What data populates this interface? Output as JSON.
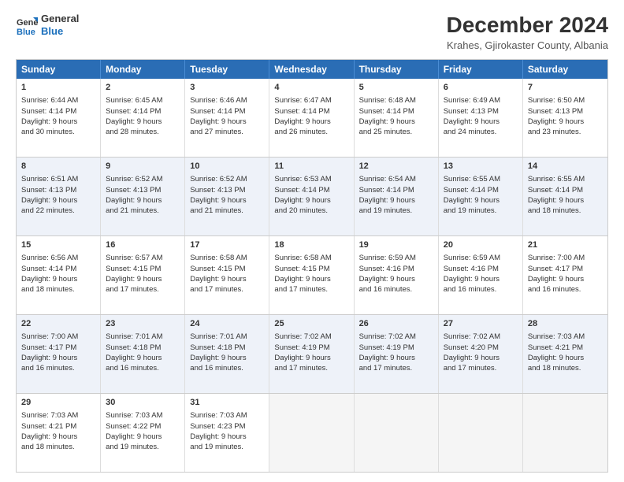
{
  "logo": {
    "general": "General",
    "blue": "Blue"
  },
  "title": "December 2024",
  "subtitle": "Krahes, Gjirokaster County, Albania",
  "weekdays": [
    "Sunday",
    "Monday",
    "Tuesday",
    "Wednesday",
    "Thursday",
    "Friday",
    "Saturday"
  ],
  "weeks": [
    [
      {
        "day": "1",
        "lines": [
          "Sunrise: 6:44 AM",
          "Sunset: 4:14 PM",
          "Daylight: 9 hours",
          "and 30 minutes."
        ]
      },
      {
        "day": "2",
        "lines": [
          "Sunrise: 6:45 AM",
          "Sunset: 4:14 PM",
          "Daylight: 9 hours",
          "and 28 minutes."
        ]
      },
      {
        "day": "3",
        "lines": [
          "Sunrise: 6:46 AM",
          "Sunset: 4:14 PM",
          "Daylight: 9 hours",
          "and 27 minutes."
        ]
      },
      {
        "day": "4",
        "lines": [
          "Sunrise: 6:47 AM",
          "Sunset: 4:14 PM",
          "Daylight: 9 hours",
          "and 26 minutes."
        ]
      },
      {
        "day": "5",
        "lines": [
          "Sunrise: 6:48 AM",
          "Sunset: 4:14 PM",
          "Daylight: 9 hours",
          "and 25 minutes."
        ]
      },
      {
        "day": "6",
        "lines": [
          "Sunrise: 6:49 AM",
          "Sunset: 4:13 PM",
          "Daylight: 9 hours",
          "and 24 minutes."
        ]
      },
      {
        "day": "7",
        "lines": [
          "Sunrise: 6:50 AM",
          "Sunset: 4:13 PM",
          "Daylight: 9 hours",
          "and 23 minutes."
        ]
      }
    ],
    [
      {
        "day": "8",
        "lines": [
          "Sunrise: 6:51 AM",
          "Sunset: 4:13 PM",
          "Daylight: 9 hours",
          "and 22 minutes."
        ]
      },
      {
        "day": "9",
        "lines": [
          "Sunrise: 6:52 AM",
          "Sunset: 4:13 PM",
          "Daylight: 9 hours",
          "and 21 minutes."
        ]
      },
      {
        "day": "10",
        "lines": [
          "Sunrise: 6:52 AM",
          "Sunset: 4:13 PM",
          "Daylight: 9 hours",
          "and 21 minutes."
        ]
      },
      {
        "day": "11",
        "lines": [
          "Sunrise: 6:53 AM",
          "Sunset: 4:14 PM",
          "Daylight: 9 hours",
          "and 20 minutes."
        ]
      },
      {
        "day": "12",
        "lines": [
          "Sunrise: 6:54 AM",
          "Sunset: 4:14 PM",
          "Daylight: 9 hours",
          "and 19 minutes."
        ]
      },
      {
        "day": "13",
        "lines": [
          "Sunrise: 6:55 AM",
          "Sunset: 4:14 PM",
          "Daylight: 9 hours",
          "and 19 minutes."
        ]
      },
      {
        "day": "14",
        "lines": [
          "Sunrise: 6:55 AM",
          "Sunset: 4:14 PM",
          "Daylight: 9 hours",
          "and 18 minutes."
        ]
      }
    ],
    [
      {
        "day": "15",
        "lines": [
          "Sunrise: 6:56 AM",
          "Sunset: 4:14 PM",
          "Daylight: 9 hours",
          "and 18 minutes."
        ]
      },
      {
        "day": "16",
        "lines": [
          "Sunrise: 6:57 AM",
          "Sunset: 4:15 PM",
          "Daylight: 9 hours",
          "and 17 minutes."
        ]
      },
      {
        "day": "17",
        "lines": [
          "Sunrise: 6:58 AM",
          "Sunset: 4:15 PM",
          "Daylight: 9 hours",
          "and 17 minutes."
        ]
      },
      {
        "day": "18",
        "lines": [
          "Sunrise: 6:58 AM",
          "Sunset: 4:15 PM",
          "Daylight: 9 hours",
          "and 17 minutes."
        ]
      },
      {
        "day": "19",
        "lines": [
          "Sunrise: 6:59 AM",
          "Sunset: 4:16 PM",
          "Daylight: 9 hours",
          "and 16 minutes."
        ]
      },
      {
        "day": "20",
        "lines": [
          "Sunrise: 6:59 AM",
          "Sunset: 4:16 PM",
          "Daylight: 9 hours",
          "and 16 minutes."
        ]
      },
      {
        "day": "21",
        "lines": [
          "Sunrise: 7:00 AM",
          "Sunset: 4:17 PM",
          "Daylight: 9 hours",
          "and 16 minutes."
        ]
      }
    ],
    [
      {
        "day": "22",
        "lines": [
          "Sunrise: 7:00 AM",
          "Sunset: 4:17 PM",
          "Daylight: 9 hours",
          "and 16 minutes."
        ]
      },
      {
        "day": "23",
        "lines": [
          "Sunrise: 7:01 AM",
          "Sunset: 4:18 PM",
          "Daylight: 9 hours",
          "and 16 minutes."
        ]
      },
      {
        "day": "24",
        "lines": [
          "Sunrise: 7:01 AM",
          "Sunset: 4:18 PM",
          "Daylight: 9 hours",
          "and 16 minutes."
        ]
      },
      {
        "day": "25",
        "lines": [
          "Sunrise: 7:02 AM",
          "Sunset: 4:19 PM",
          "Daylight: 9 hours",
          "and 17 minutes."
        ]
      },
      {
        "day": "26",
        "lines": [
          "Sunrise: 7:02 AM",
          "Sunset: 4:19 PM",
          "Daylight: 9 hours",
          "and 17 minutes."
        ]
      },
      {
        "day": "27",
        "lines": [
          "Sunrise: 7:02 AM",
          "Sunset: 4:20 PM",
          "Daylight: 9 hours",
          "and 17 minutes."
        ]
      },
      {
        "day": "28",
        "lines": [
          "Sunrise: 7:03 AM",
          "Sunset: 4:21 PM",
          "Daylight: 9 hours",
          "and 18 minutes."
        ]
      }
    ],
    [
      {
        "day": "29",
        "lines": [
          "Sunrise: 7:03 AM",
          "Sunset: 4:21 PM",
          "Daylight: 9 hours",
          "and 18 minutes."
        ]
      },
      {
        "day": "30",
        "lines": [
          "Sunrise: 7:03 AM",
          "Sunset: 4:22 PM",
          "Daylight: 9 hours",
          "and 19 minutes."
        ]
      },
      {
        "day": "31",
        "lines": [
          "Sunrise: 7:03 AM",
          "Sunset: 4:23 PM",
          "Daylight: 9 hours",
          "and 19 minutes."
        ]
      },
      {
        "day": "",
        "lines": []
      },
      {
        "day": "",
        "lines": []
      },
      {
        "day": "",
        "lines": []
      },
      {
        "day": "",
        "lines": []
      }
    ]
  ]
}
